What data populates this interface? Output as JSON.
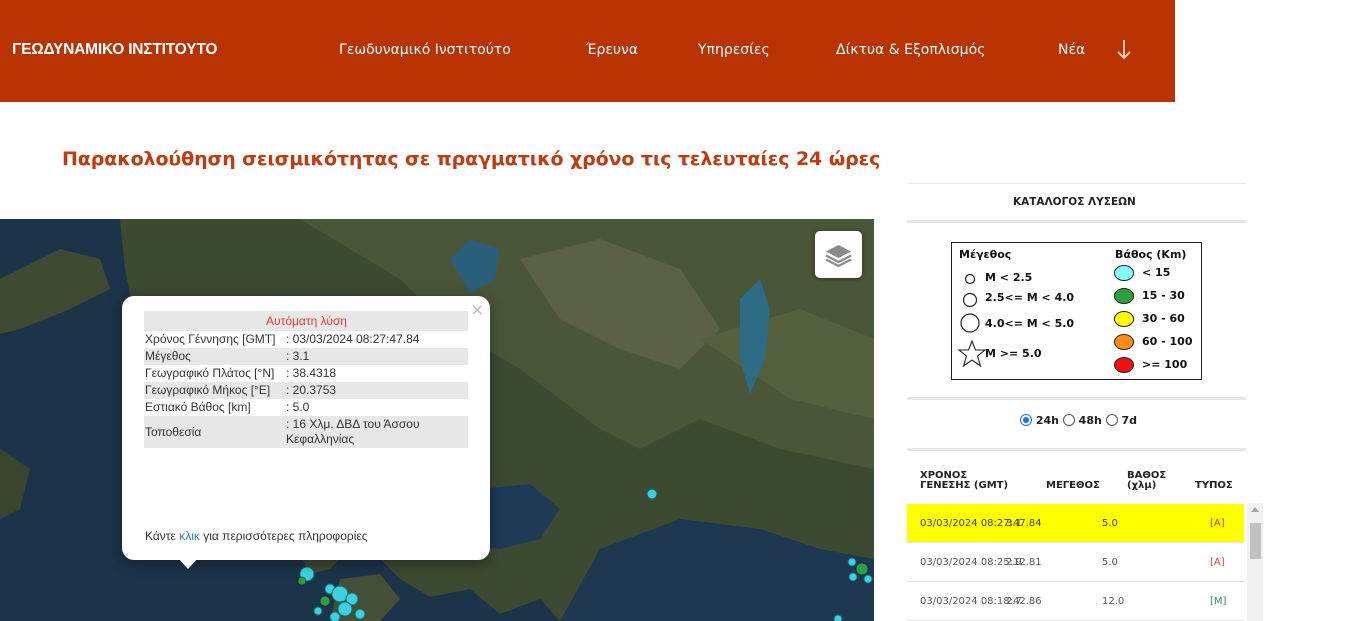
{
  "header": {
    "brand": "ΓΕΩΔΥΝΑΜΙΚΟ ΙΝΣΤΙΤΟΥΤΟ",
    "nav": [
      "Γεωδυναμικό Ινστιτούτο",
      "Έρευνα",
      "Υπηρεσίες",
      "Δίκτυα & Εξοπλισμός",
      "Νέα"
    ],
    "bg_color": "#b83202"
  },
  "page_title": "Παρακολούθηση σεισμικότητας σε πραγματικό χρόνο τις τελευταίες 24 ώρες",
  "popup": {
    "heading": "Αυτόματη λύση",
    "close": "×",
    "fields": [
      {
        "label": "Χρόνος Γέννησης [GMT]",
        "value": ": 03/03/2024 08:27:47.84"
      },
      {
        "label": "Μέγεθος",
        "value": ": 3.1"
      },
      {
        "label": "Γεωγραφικό Πλάτος [°N]",
        "value": ": 38.4318"
      },
      {
        "label": "Γεωγραφικό Μήκος [°E]",
        "value": ": 20.3753"
      },
      {
        "label": "Εστιακό Βάθος [km]",
        "value": ": 5.0"
      },
      {
        "label": "Τοποθεσία",
        "value": ": 16 Χλμ. ΔΒΔ του Άσσου Κεφαλληνίας"
      }
    ],
    "more_prefix": "Κάντε ",
    "more_link": "κλικ",
    "more_suffix": " για περισσότερες πληροφορίες"
  },
  "catalog": {
    "title": "ΚΑΤΑΛΟΓΟΣ ΛΥΣΕΩΝ",
    "legend": {
      "mag_title": "Μέγεθος",
      "depth_title": "Βάθος (Km)",
      "mag_items": [
        "M < 2.5",
        "2.5<= M < 4.0",
        "4.0<= M < 5.0",
        "M >= 5.0"
      ],
      "depth_items": [
        {
          "label": "< 15",
          "color": "#7fffff"
        },
        {
          "label": "15 - 30",
          "color": "#2e9e3e"
        },
        {
          "label": "30 - 60",
          "color": "#ffff00"
        },
        {
          "label": "60 - 100",
          "color": "#ff8c1a"
        },
        {
          "label": ">= 100",
          "color": "#ee1111"
        }
      ]
    },
    "periods": [
      "24h",
      "48h",
      "7d"
    ],
    "selected_period": "24h",
    "columns": {
      "time_l1": "ΧΡΟΝΟΣ",
      "time_l2": "ΓΕΝΕΣΗΣ (GMT)",
      "mag": "ΜΕΓΕΘΟΣ",
      "depth_l1": "ΒΑΘΟΣ",
      "depth_l2": "(χλμ)",
      "type": "ΤΥΠΟΣ"
    },
    "rows": [
      {
        "time": "03/03/2024 08:27:47.84",
        "mag": "3.1",
        "depth": "5.0",
        "type": "[A]"
      },
      {
        "time": "03/03/2024 08:25:12.81",
        "mag": "2.9",
        "depth": "5.0",
        "type": "[A]"
      },
      {
        "time": "03/03/2024 08:18:42.86",
        "mag": "2.7",
        "depth": "12.0",
        "type": "[M]"
      }
    ]
  }
}
